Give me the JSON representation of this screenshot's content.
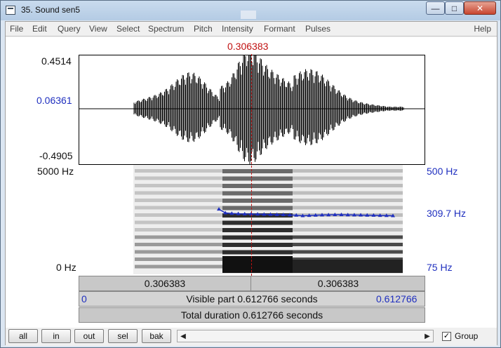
{
  "window": {
    "title": "35. Sound sen5"
  },
  "menu": [
    "File",
    "Edit",
    "Query",
    "View",
    "Select",
    "Spectrum",
    "Pitch",
    "Intensity",
    "Formant",
    "Pulses"
  ],
  "help_label": "Help",
  "cursor": {
    "time_label": "0.306383"
  },
  "waveform": {
    "y_max": "0.4514",
    "y_cursor": "0.06361",
    "y_min": "-0.4905"
  },
  "spectrogram": {
    "freq_top": "5000 Hz",
    "freq_bottom": "0 Hz",
    "pitch_top": "500 Hz",
    "pitch_cursor": "309.7 Hz",
    "pitch_bottom": "75 Hz"
  },
  "bars": {
    "left_time": "0.306383",
    "right_time": "0.306383",
    "visible_start": "0",
    "visible_label": "Visible part 0.612766 seconds",
    "visible_end": "0.612766",
    "total_label": "Total duration 0.612766 seconds"
  },
  "toolbar": {
    "all": "all",
    "in": "in",
    "out": "out",
    "sel": "sel",
    "bak": "bak",
    "group_label": "Group",
    "group_checked": true
  },
  "colors": {
    "pitch": "#1f2fbf",
    "cursor": "#c01010"
  },
  "pitch_track": {
    "hz": [
      318,
      314,
      312,
      311,
      310,
      309.5,
      309,
      308.5,
      308,
      307.5,
      307,
      306,
      305,
      303,
      304,
      305,
      306,
      306.5,
      307,
      307,
      306.5,
      306,
      305.5,
      305,
      304.5,
      304,
      303.5,
      303
    ]
  }
}
